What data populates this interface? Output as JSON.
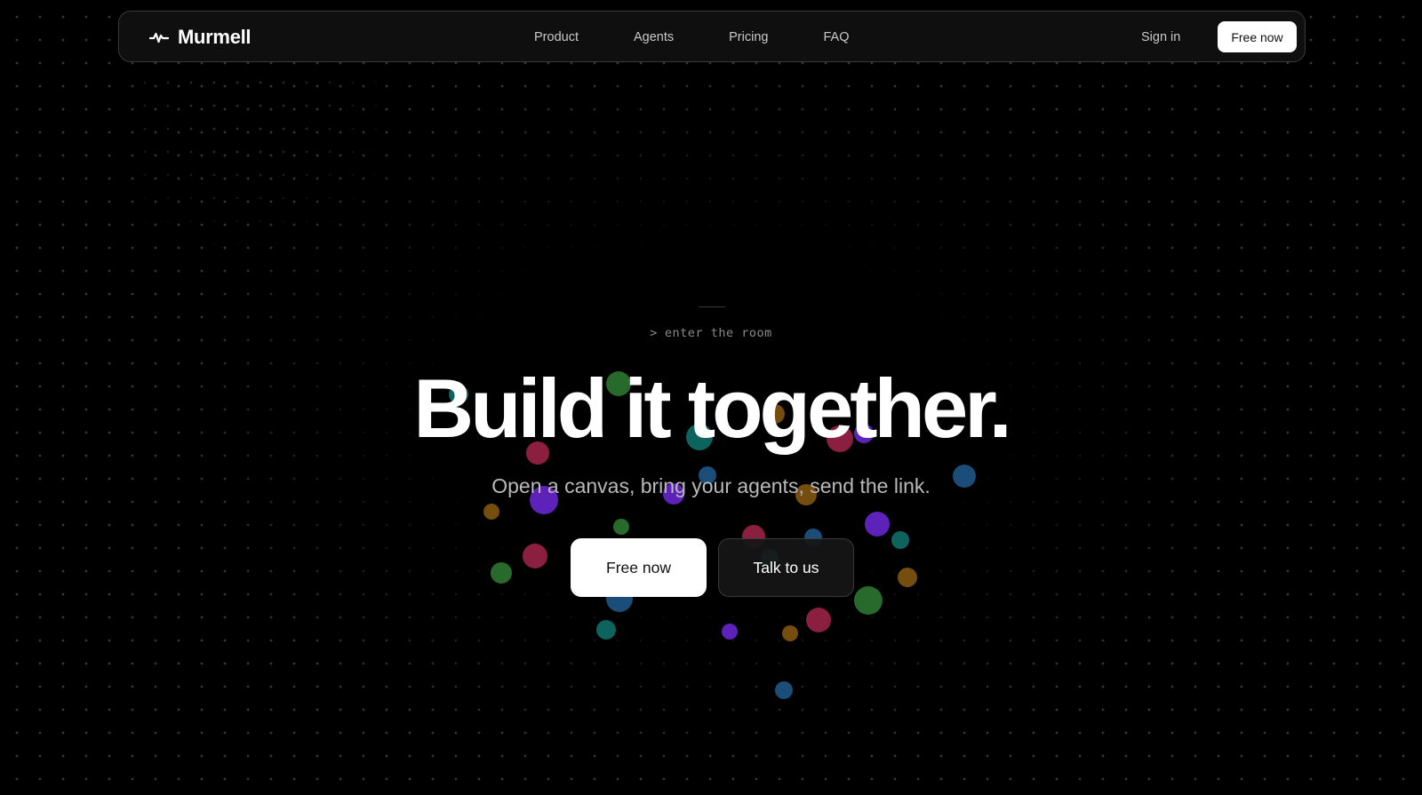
{
  "brand": {
    "name": "Murmell",
    "logo_icon": "pulse-icon"
  },
  "nav": {
    "links": [
      "Product",
      "Agents",
      "Pricing",
      "FAQ"
    ],
    "sign_in": "Sign in",
    "cta": "Free now"
  },
  "hero": {
    "eyebrow_caret": ">",
    "eyebrow": "enter the room",
    "headline": "Build it together.",
    "subhead": "Open a canvas, bring your agents, send the link.",
    "primary_cta": "Free now",
    "secondary_cta": "Talk to us"
  },
  "colors": {
    "background": "#000000",
    "text": "#ffffff",
    "muted": "#b9b9b9",
    "orb_green": "#2e7d32",
    "orb_teal": "#0f766e",
    "orb_crimson": "#a3244a",
    "orb_purple": "#6d28d9",
    "orb_blue": "#1e5a8c",
    "orb_amber": "#8a5a10"
  }
}
